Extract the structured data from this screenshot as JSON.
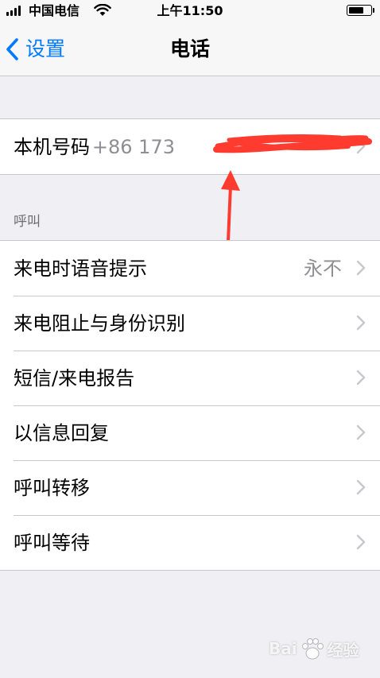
{
  "status_bar": {
    "carrier": "中国电信",
    "time": "上午11:50",
    "signal_bars": 4,
    "battery_level": 0.7
  },
  "nav": {
    "back_label": "设置",
    "title": "电话"
  },
  "my_number": {
    "label": "本机号码",
    "value": "+86 173"
  },
  "calls_section": {
    "header": "呼叫",
    "items": [
      {
        "label": "来电时语音提示",
        "value": "永不"
      },
      {
        "label": "来电阻止与身份识别",
        "value": ""
      },
      {
        "label": "短信/来电报告",
        "value": ""
      },
      {
        "label": "以信息回复",
        "value": ""
      },
      {
        "label": "呼叫转移",
        "value": ""
      },
      {
        "label": "呼叫等待",
        "value": ""
      }
    ]
  },
  "watermark": {
    "left": "Bai",
    "right": "经验"
  },
  "colors": {
    "accent": "#007aff",
    "background": "#efeff4",
    "annotation": "#ff3b30"
  },
  "icons": [
    "signal-icon",
    "wifi-icon",
    "battery-icon",
    "back-chevron-icon",
    "chevron-right-icon",
    "baidu-paw-icon"
  ]
}
